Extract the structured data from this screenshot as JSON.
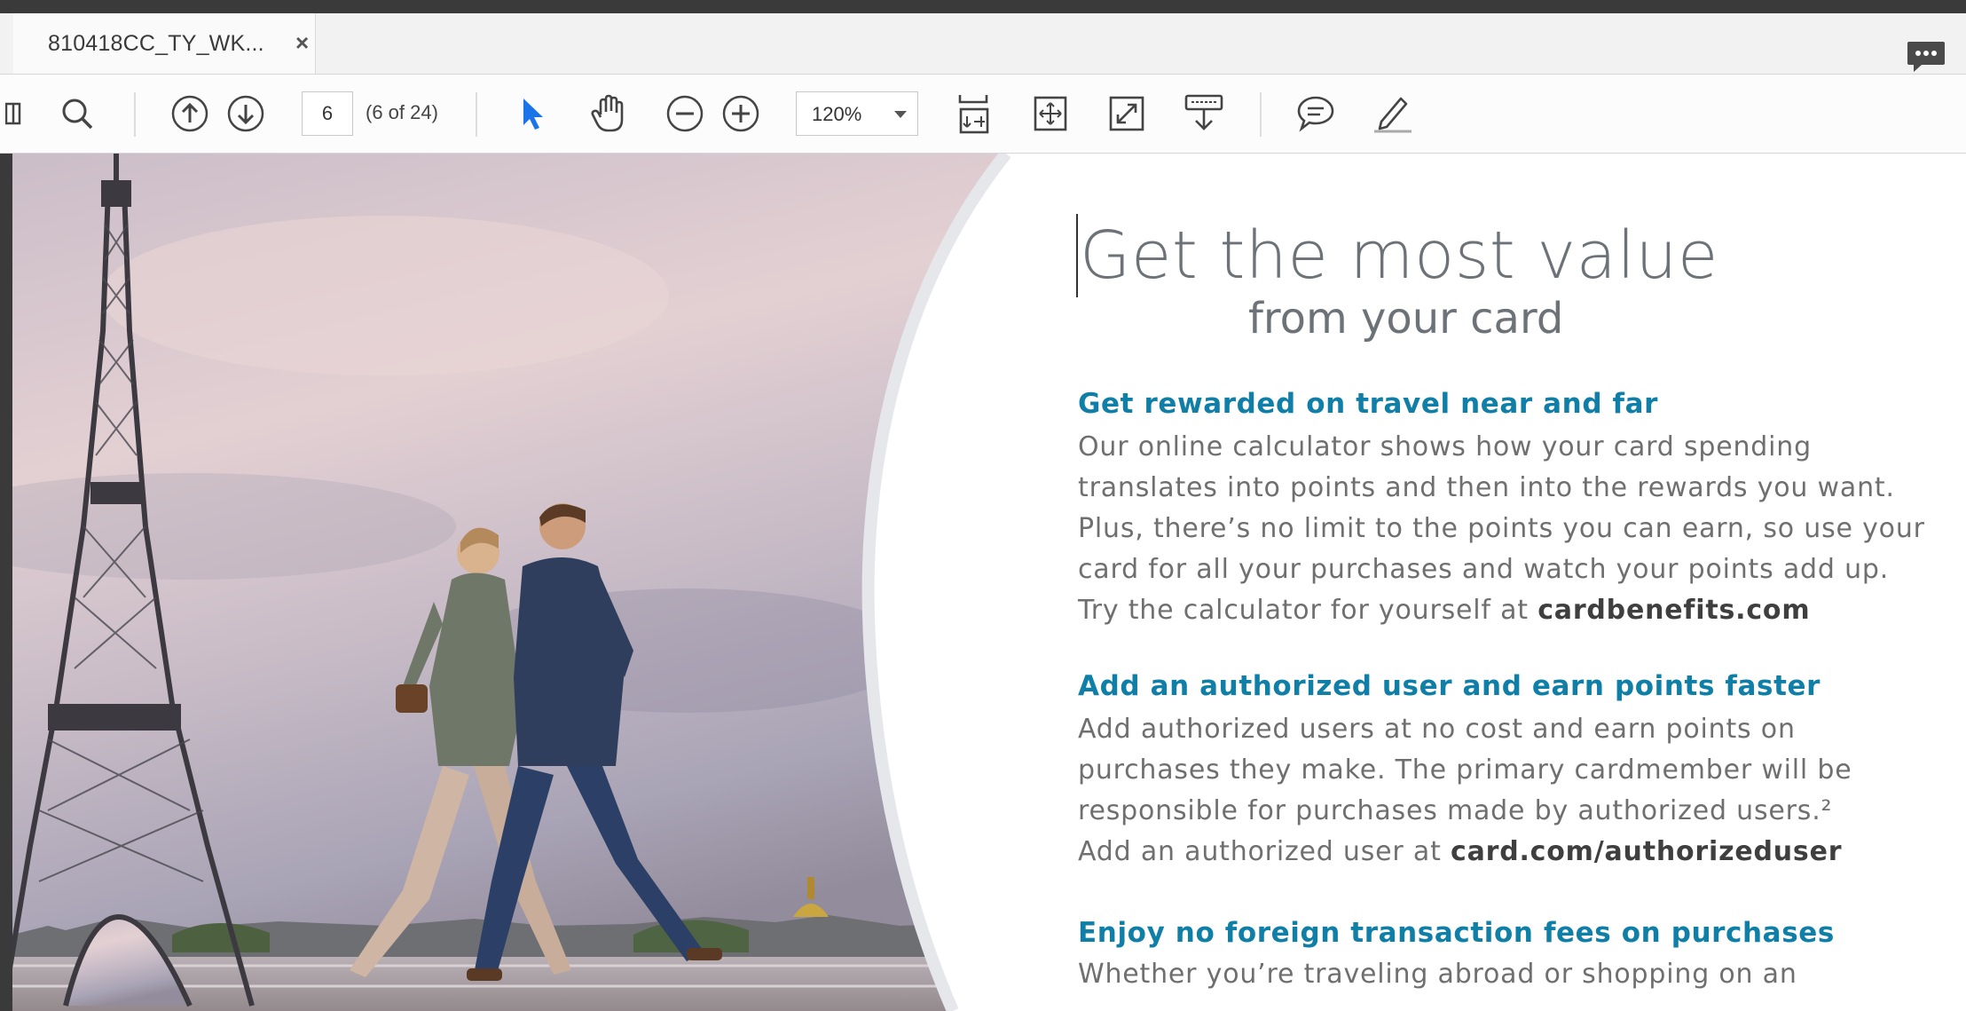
{
  "tab": {
    "title": "810418CC_TY_WK...",
    "close": "×"
  },
  "toolbar": {
    "page_value": "6",
    "page_count": "(6 of 24)",
    "zoom": "120%",
    "icons": [
      "sidebar-icon",
      "search-icon",
      "prev-page-icon",
      "next-page-icon",
      "select-icon",
      "hand-icon",
      "zoom-out-icon",
      "zoom-in-icon",
      "fit-page-icon",
      "fit-width-icon",
      "full-screen-icon",
      "read-mode-icon",
      "comment-icon",
      "sign-icon"
    ]
  },
  "document": {
    "heading": "Get the most value",
    "subheading": "from your card",
    "sections": [
      {
        "title": "Get rewarded on travel near and far",
        "lines": [
          "Our online calculator shows how your card spending",
          "translates into points and then into the rewards you want.",
          "Plus, there’s no limit to the points you can earn, so use your",
          "card for all your purchases and watch your points add up."
        ],
        "last_line_text": "Try the calculator for yourself at ",
        "last_line_link": "cardbenefits.com"
      },
      {
        "title": "Add an authorized user and earn points faster",
        "lines": [
          "Add authorized users at no cost and earn points on",
          "purchases they make. The primary cardmember will be",
          "responsible for purchases made by authorized users.²"
        ],
        "last_line_text": "Add an authorized user at ",
        "last_line_link": "card.com/authorizeduser"
      },
      {
        "title": "Enjoy no foreign transaction fees on purchases",
        "lines": [
          "Whether you’re traveling abroad or shopping on an"
        ]
      }
    ]
  },
  "colors": {
    "heading": "#6d7278",
    "section_title": "#0f7fa8",
    "body_text": "#6f6f6f",
    "select_tool": "#1a73e8"
  }
}
